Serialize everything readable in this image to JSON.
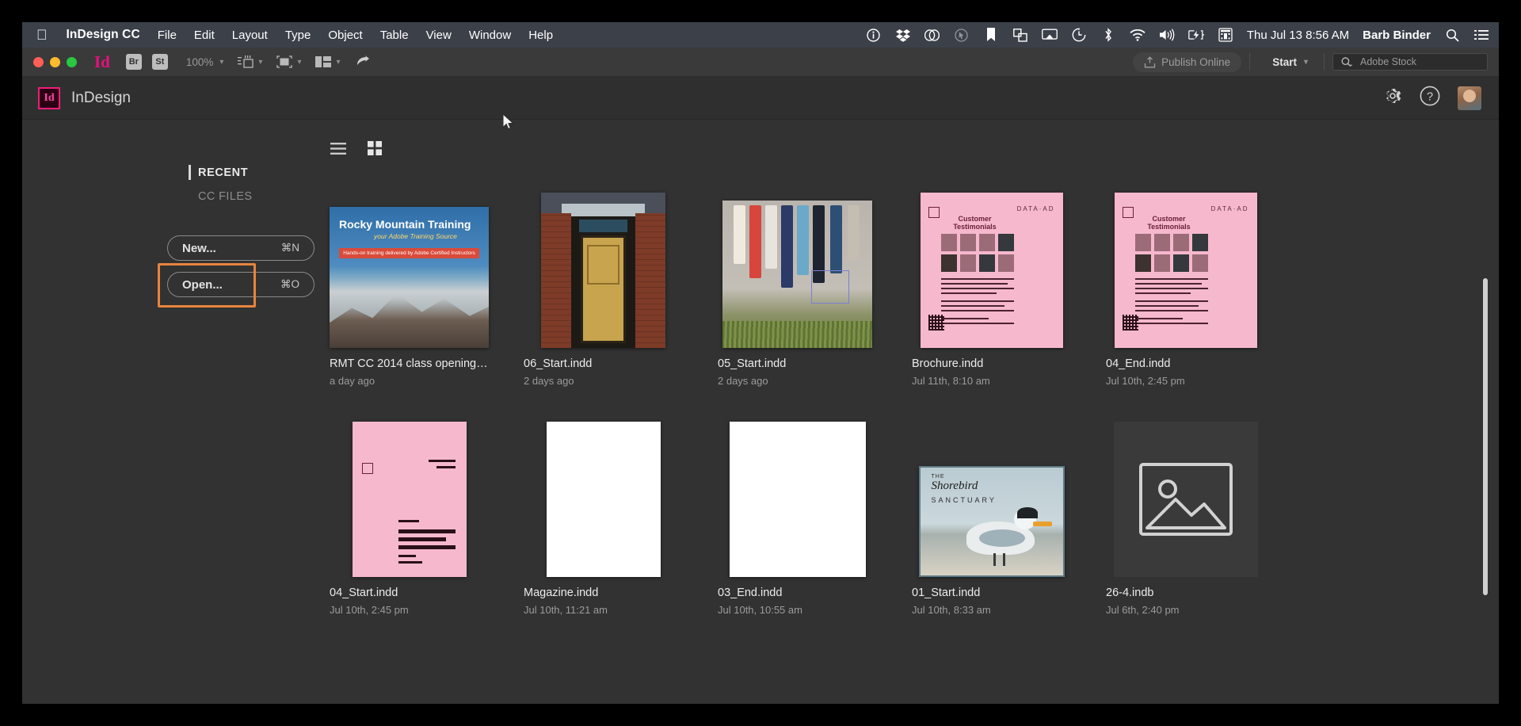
{
  "menubar": {
    "apple": "apple-logo",
    "app_name": "InDesign CC",
    "items": [
      "File",
      "Edit",
      "Layout",
      "Type",
      "Object",
      "Table",
      "View",
      "Window",
      "Help"
    ],
    "status_icons": [
      "info-icon",
      "dropbox-icon",
      "creative-cloud-icon",
      "cursor-disabled-icon",
      "bookmark-icon",
      "copy-icon",
      "airplay-icon",
      "time-machine-icon",
      "bluetooth-icon",
      "wifi-icon",
      "volume-icon",
      "battery-charging-icon",
      "keyboard-input-icon"
    ],
    "datetime": "Thu Jul 13  8:56 AM",
    "user": "Barb Binder",
    "search_icon": "search-icon",
    "list_icon": "notification-center-icon"
  },
  "toolbar": {
    "id_mark": "Id",
    "bridge_label": "Br",
    "stock_label": "St",
    "zoom_value": "100%",
    "publish_label": "Publish Online",
    "start_label": "Start",
    "stock_placeholder": "Adobe Stock"
  },
  "home_header": {
    "logo_text": "Id",
    "title": "InDesign",
    "gear_icon": "gear-icon",
    "help_icon": "help-icon",
    "avatar": "user-avatar"
  },
  "sidebar": {
    "tabs": [
      {
        "label": "RECENT",
        "active": true
      },
      {
        "label": "CC FILES",
        "active": false
      }
    ],
    "buttons": [
      {
        "label": "New...",
        "shortcut": "⌘N"
      },
      {
        "label": "Open...",
        "shortcut": "⌘O"
      }
    ],
    "highlight_color": "#e8843c"
  },
  "content": {
    "view_list_icon": "list-view-icon",
    "view_grid_icon": "grid-view-icon",
    "files": [
      {
        "name": "RMT CC 2014 class opening.i...",
        "date": "a day ago",
        "thumb": "rmt",
        "rmt": {
          "title_plain": "Rocky Mountain ",
          "title_bold": "Training",
          "subtitle": "your Adobe Training Source",
          "band": "Hands-on training delivered by Adobe Certified Instructors"
        }
      },
      {
        "name": "06_Start.indd",
        "date": "2 days ago",
        "thumb": "door"
      },
      {
        "name": "05_Start.indd",
        "date": "2 days ago",
        "thumb": "cloth"
      },
      {
        "name": "Brochure.indd",
        "date": "Jul 11th, 8:10 am",
        "thumb": "pink",
        "pink": {
          "heading": "Customer Testimonials",
          "corner": "DATA·AD"
        }
      },
      {
        "name": "04_End.indd",
        "date": "Jul 10th, 2:45 pm",
        "thumb": "pink",
        "pink": {
          "heading": "Customer Testimonials",
          "corner": "DATA·AD"
        }
      },
      {
        "name": "04_Start.indd",
        "date": "Jul 10th, 2:45 pm",
        "thumb": "pink2"
      },
      {
        "name": "Magazine.indd",
        "date": "Jul 10th, 11:21 am",
        "thumb": "white"
      },
      {
        "name": "03_End.indd",
        "date": "Jul 10th, 10:55 am",
        "thumb": "white2"
      },
      {
        "name": "01_Start.indd",
        "date": "Jul 10th, 8:33 am",
        "thumb": "bird",
        "bird": {
          "line1": "THE",
          "line2": "Shorebird",
          "line3": "SANCTUARY"
        }
      },
      {
        "name": "26-4.indb",
        "date": "Jul 6th, 2:40 pm",
        "thumb": "placeholder"
      }
    ]
  }
}
